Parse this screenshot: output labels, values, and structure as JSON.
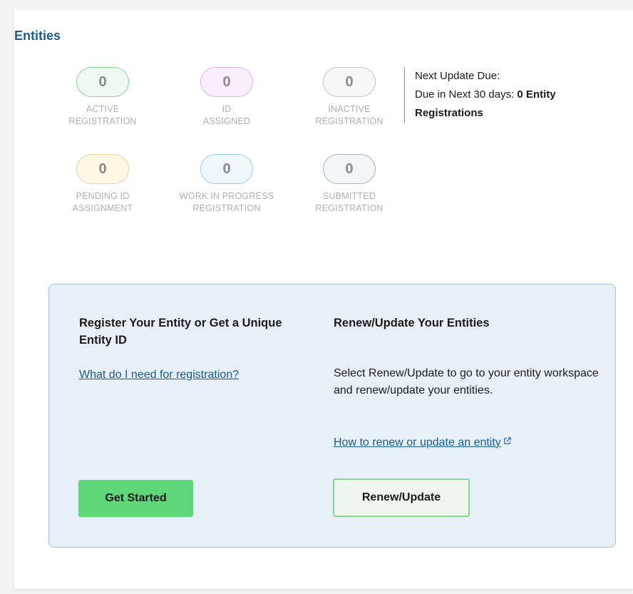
{
  "section": {
    "title": "Entities"
  },
  "statuses": [
    {
      "count": "0",
      "label_lines": [
        "ACTIVE",
        "REGISTRATION"
      ],
      "color": "#8fd19a"
    },
    {
      "count": "0",
      "label_lines": [
        "ID",
        "ASSIGNED"
      ],
      "color": "#dab6ea"
    },
    {
      "count": "0",
      "label_lines": [
        "INACTIVE",
        "REGISTRATION"
      ],
      "color": "#c7c7c7"
    },
    {
      "count": "0",
      "label_lines": [
        "PENDING ID",
        "ASSIGNMENT"
      ],
      "color": "#ecd596"
    },
    {
      "count": "0",
      "label_lines": [
        "WORK IN PROGRESS",
        "REGISTRATION"
      ],
      "color": "#97d3e2"
    },
    {
      "count": "0",
      "label_lines": [
        "SUBMITTED",
        "REGISTRATION"
      ],
      "color": "#a9b7c3"
    }
  ],
  "next_update": {
    "heading": "Next Update Due:",
    "due_prefix": "Due in Next 30 days:",
    "due_count": "0 Entity",
    "due_suffix": "Registrations"
  },
  "register": {
    "heading": "Register Your Entity or Get a Unique Entity ID",
    "link": "What do I need for registration?",
    "button": "Get Started"
  },
  "renew": {
    "heading": "Renew/Update Your Entities",
    "description": "Select Renew/Update to go to your entity workspace and renew/update your entities.",
    "link": "How to renew or update an entity",
    "link_icon": "external-link-icon",
    "button": "Renew/Update"
  },
  "colors": {
    "title": "#1a5c92",
    "panel_bg": "#e8f0f7",
    "primary_button": "#5fd679",
    "secondary_button_border": "#85d693"
  }
}
